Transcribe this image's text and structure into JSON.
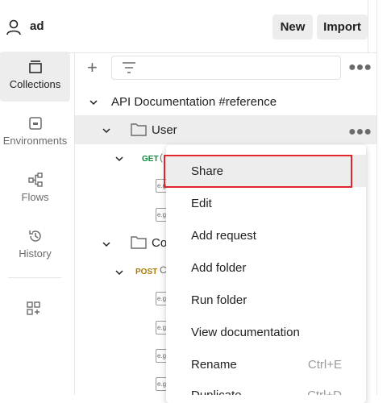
{
  "header": {
    "workspace": "ad",
    "new_label": "New",
    "import_label": "Import"
  },
  "sidebar": {
    "items": [
      {
        "label": "Collections",
        "icon": "collections-icon",
        "active": true
      },
      {
        "label": "Environments",
        "icon": "environments-icon"
      },
      {
        "label": "Flows",
        "icon": "flows-icon"
      },
      {
        "label": "History",
        "icon": "history-icon"
      }
    ]
  },
  "tree": {
    "collection": "API Documentation #reference",
    "folder1": "User",
    "folder2": "Co",
    "get_method": "GET",
    "post_method": "POST",
    "get_partial": "(",
    "post_partial": "C",
    "example_icon": "e.g"
  },
  "menu": {
    "items": [
      {
        "label": "Share"
      },
      {
        "label": "Edit"
      },
      {
        "label": "Add request"
      },
      {
        "label": "Add folder"
      },
      {
        "label": "Run folder"
      },
      {
        "label": "View documentation"
      },
      {
        "label": "Rename",
        "shortcut": "Ctrl+E"
      },
      {
        "label": "Duplicate",
        "shortcut": "Ctrl+D"
      }
    ]
  },
  "colors": {
    "get": "#0f8a3f",
    "post": "#ad7a03",
    "highlight_border": "#e0252d"
  }
}
